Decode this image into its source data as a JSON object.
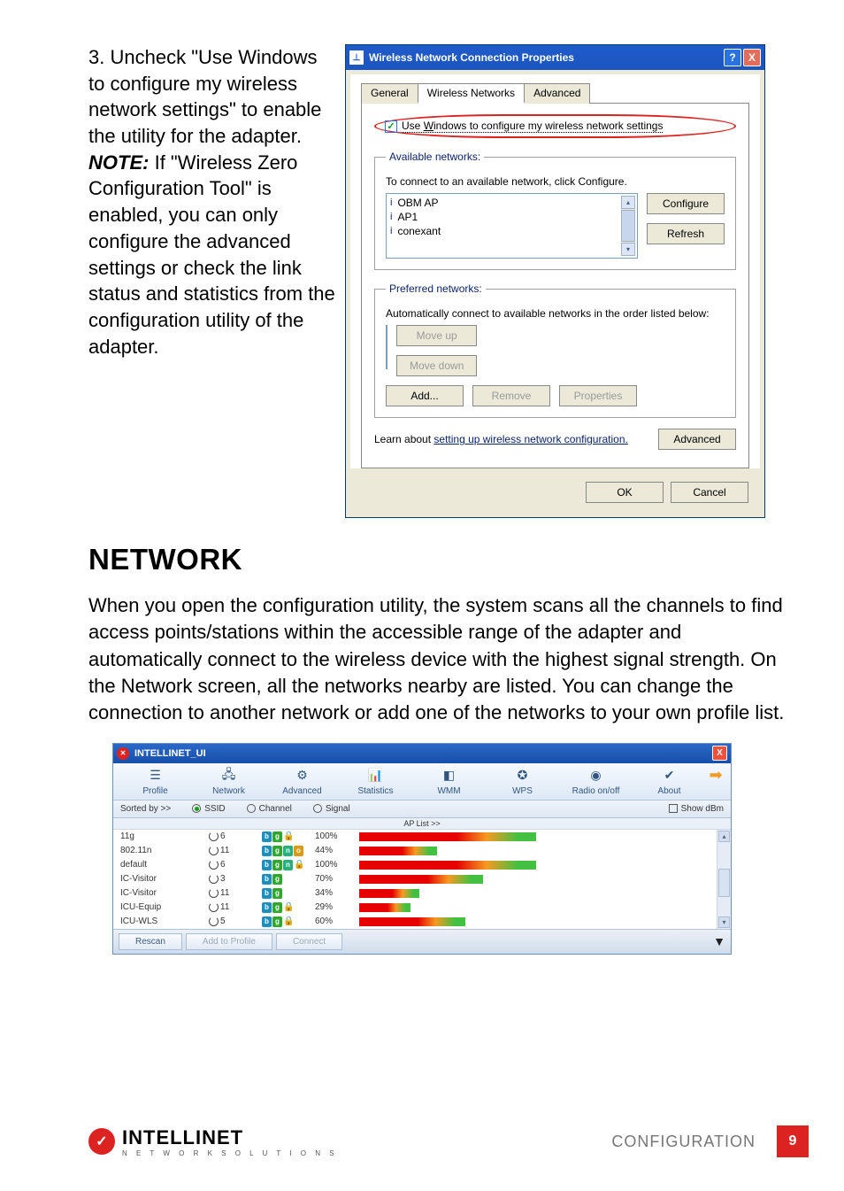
{
  "instruction": {
    "number": "3.",
    "text_a": "Uncheck \"Use Windows to configure my wireless network settings\" to enable the utility for the adapter. ",
    "note_label": "NOTE:",
    "text_b": " If \"Wireless Zero Configuration Tool\" is enabled, you can only configure the advanced settings or check the link status and statistics from the configuration utility of the adapter."
  },
  "dlg": {
    "title": "Wireless Network Connection Properties",
    "tabs": {
      "general": "General",
      "wireless": "Wireless Networks",
      "advanced": "Advanced"
    },
    "checkbox_pre": "Use ",
    "checkbox_uw": "W",
    "checkbox_post": "indows to configure my wireless network settings",
    "available": {
      "legend": "Available networks:",
      "desc": "To connect to an available network, click Configure.",
      "items": [
        "OBM AP",
        "AP1",
        "conexant"
      ],
      "configure": "Configure",
      "refresh": "Refresh"
    },
    "preferred": {
      "legend": "Preferred networks:",
      "desc": "Automatically connect to available networks in the order listed below:",
      "moveup": "Move up",
      "movedown": "Move down",
      "add": "Add...",
      "remove": "Remove",
      "properties": "Properties"
    },
    "learn_a": "Learn about ",
    "learn_link": "setting up wireless network configuration.",
    "advanced_btn": "Advanced",
    "ok": "OK",
    "cancel": "Cancel"
  },
  "network": {
    "heading": "NETWORK",
    "paragraph": "When you open the configuration utility, the system scans all the channels to find access points/stations within the accessible range of the adapter and automatically connect to the wireless device with the highest signal strength. On the Network screen, all the networks nearby are listed. You can change the connection to another network or add one of the networks to your own profile list."
  },
  "iui": {
    "title": "INTELLINET_UI",
    "toolbar": {
      "profile": "Profile",
      "network": "Network",
      "advanced": "Advanced",
      "statistics": "Statistics",
      "wmm": "WMM",
      "wps": "WPS",
      "radio": "Radio on/off",
      "about": "About"
    },
    "sort": {
      "label": "Sorted by >>",
      "ssid": "SSID",
      "channel": "Channel",
      "signal": "Signal",
      "showdbm": "Show dBm",
      "aplist": "AP List >>"
    },
    "rows": [
      {
        "ssid": "11g",
        "ch": "6",
        "enc": [
          "b",
          "g"
        ],
        "lock": true,
        "sig": "100%",
        "pct": 100
      },
      {
        "ssid": "802.11n",
        "ch": "11",
        "enc": [
          "b",
          "g",
          "n",
          "o"
        ],
        "lock": false,
        "sig": "44%",
        "pct": 44
      },
      {
        "ssid": "default",
        "ch": "6",
        "enc": [
          "b",
          "g",
          "n"
        ],
        "lock": true,
        "sig": "100%",
        "pct": 100
      },
      {
        "ssid": "IC-Visitor",
        "ch": "3",
        "enc": [
          "b",
          "g"
        ],
        "lock": false,
        "sig": "70%",
        "pct": 70
      },
      {
        "ssid": "IC-Visitor",
        "ch": "11",
        "enc": [
          "b",
          "g"
        ],
        "lock": false,
        "sig": "34%",
        "pct": 34
      },
      {
        "ssid": "ICU-Equip",
        "ch": "11",
        "enc": [
          "b",
          "g"
        ],
        "lock": true,
        "sig": "29%",
        "pct": 29
      },
      {
        "ssid": "ICU-WLS",
        "ch": "5",
        "enc": [
          "b",
          "g"
        ],
        "lock": true,
        "sig": "60%",
        "pct": 60
      }
    ],
    "footer": {
      "rescan": "Rescan",
      "add": "Add to Profile",
      "connect": "Connect"
    }
  },
  "footer": {
    "brand_top": "INTELLINET",
    "brand_bot": "N E T W O R K   S O L U T I O N S",
    "section": "CONFIGURATION",
    "page": "9"
  }
}
